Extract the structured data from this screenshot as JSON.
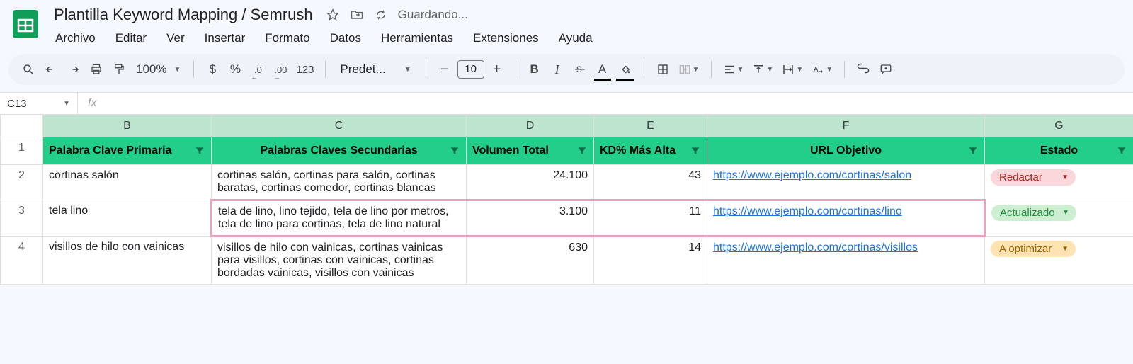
{
  "doc": {
    "title": "Plantilla Keyword Mapping / Semrush",
    "saving": "Guardando..."
  },
  "menu": {
    "file": "Archivo",
    "edit": "Editar",
    "view": "Ver",
    "insert": "Insertar",
    "format": "Formato",
    "data": "Datos",
    "tools": "Herramientas",
    "extensions": "Extensiones",
    "help": "Ayuda"
  },
  "toolbar": {
    "zoom": "100%",
    "currency": "$",
    "percent": "%",
    "dec_dec": ".0",
    "inc_dec": ".00",
    "onetwothree": "123",
    "font": "Predet...",
    "font_size": "10",
    "bold": "B",
    "italic": "I",
    "text_color_letter": "A"
  },
  "namebox": {
    "ref": "C13"
  },
  "columns": {
    "B": "B",
    "C": "C",
    "D": "D",
    "E": "E",
    "F": "F",
    "G": "G"
  },
  "headers": {
    "B": "Palabra Clave Primaria",
    "C": "Palabras Claves Secundarias",
    "D": "Volumen Total",
    "E": "KD% Más Alta",
    "F": "URL Objetivo",
    "G": "Estado"
  },
  "rows": [
    {
      "n": "2",
      "primary": "cortinas salón",
      "secondary": "cortinas salón, cortinas para salón, cortinas baratas, cortinas comedor, cortinas blancas",
      "volume": "24.100",
      "kd": "43",
      "url": "https://www.ejemplo.com/cortinas/salon",
      "status": "Redactar",
      "status_class": "pill-red"
    },
    {
      "n": "3",
      "primary": "tela lino",
      "secondary": "tela de lino, lino tejido, tela de lino por metros, tela de lino para cortinas, tela de lino natural",
      "volume": "3.100",
      "kd": "11",
      "url": "https://www.ejemplo.com/cortinas/lino",
      "status": "Actualizado",
      "status_class": "pill-green",
      "highlight": true
    },
    {
      "n": "4",
      "primary": "visillos de hilo con vainicas",
      "secondary": "visillos de hilo con vainicas, cortinas vainicas para visillos, cortinas con vainicas, cortinas bordadas vainicas, visillos con vainicas",
      "volume": "630",
      "kd": "14",
      "url": "https://www.ejemplo.com/cortinas/visillos",
      "status": "A optimizar",
      "status_class": "pill-orange"
    }
  ]
}
